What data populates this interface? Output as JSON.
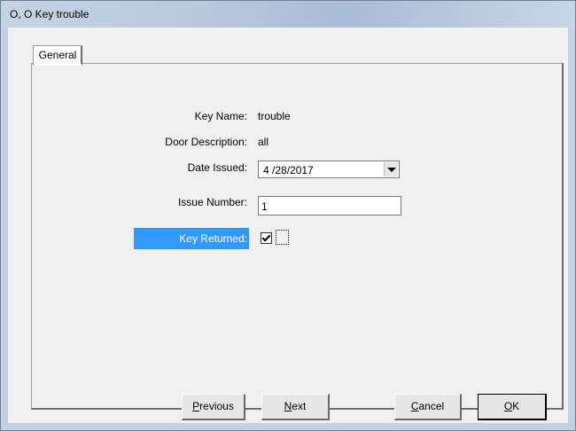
{
  "window": {
    "title": "O, O  Key trouble"
  },
  "tabs": [
    {
      "label": "General"
    }
  ],
  "form": {
    "key_name_label": "Key Name:",
    "key_name_value": "trouble",
    "door_description_label": "Door Description:",
    "door_description_value": "all",
    "date_issued_label": "Date Issued:",
    "date_issued_value": "4 /28/2017",
    "issue_number_label": "Issue Number:",
    "issue_number_value": "1",
    "key_returned_label": "Key Returned:",
    "key_returned_checked": true
  },
  "buttons": {
    "previous": {
      "mnemonic": "P",
      "rest": "revious"
    },
    "next": {
      "mnemonic": "N",
      "rest": "ext"
    },
    "cancel": {
      "mnemonic": "C",
      "rest": "ancel"
    },
    "ok": {
      "mnemonic": "O",
      "rest": "K"
    }
  },
  "colors": {
    "selection_highlight": "#3399ff",
    "titlebar": "#b8c9de"
  }
}
